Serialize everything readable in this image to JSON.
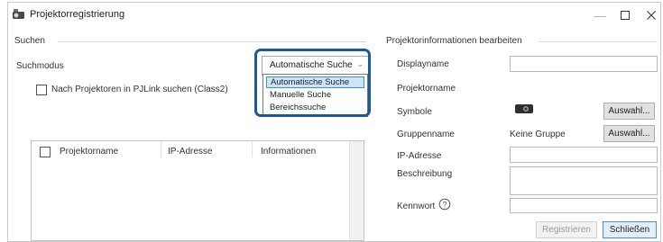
{
  "window": {
    "title": "Projektorregistrierung",
    "controls": {
      "minimize": "—",
      "maximize": "☐",
      "close": "✕"
    }
  },
  "search": {
    "group_label": "Suchen",
    "mode_label": "Suchmodus",
    "pjlink_checkbox_label": "Nach Projektoren in PJLink suchen (Class2)",
    "pjlink_checked": false,
    "mode_selected": "Automatische Suche",
    "mode_options": [
      "Automatische Suche",
      "Manuelle Suche",
      "Bereichssuche"
    ]
  },
  "table": {
    "columns": [
      "Projektorname",
      "IP-Adresse",
      "Informationen"
    ],
    "rows": []
  },
  "edit": {
    "group_label": "Projektorinformationen bearbeiten",
    "display_name_label": "Displayname",
    "projector_name_label": "Projektorname",
    "symbol_label": "Symbole",
    "group_name_label": "Gruppenname",
    "group_name_value": "Keine Gruppe",
    "ip_label": "IP-Adresse",
    "description_label": "Beschreibung",
    "password_label": "Kennwort",
    "choose_button": "Auswahl...",
    "register_button": "Registrieren",
    "close_button": "Schließen"
  },
  "colors": {
    "highlight_border": "#1a5a96",
    "selected_item_bg": "#cce4f7"
  }
}
